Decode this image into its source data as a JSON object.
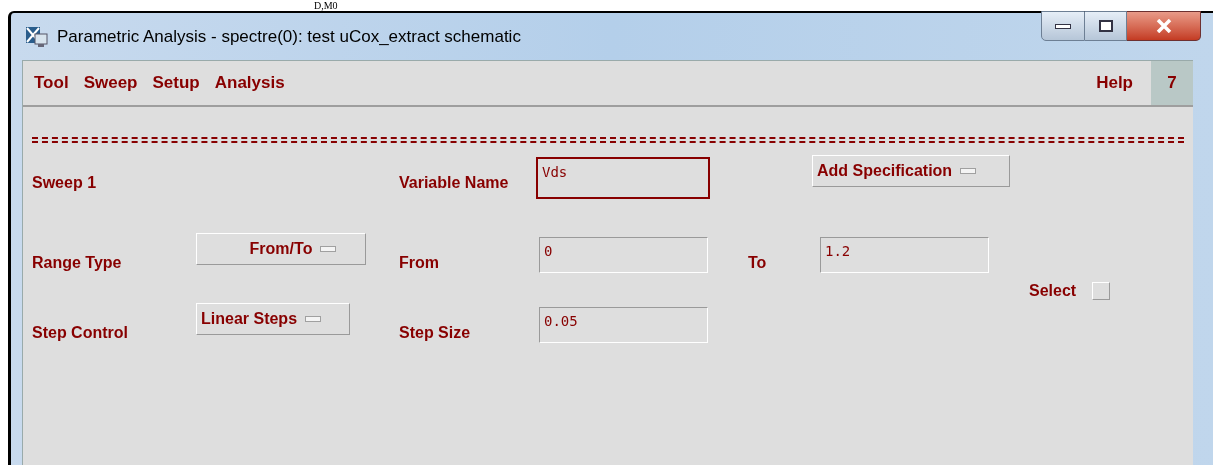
{
  "background_text": "D,M0",
  "window": {
    "title": "Parametric Analysis - spectre(0): test uCox_extract schematic"
  },
  "menu_bar": {
    "items": [
      "Tool",
      "Sweep",
      "Setup",
      "Analysis"
    ],
    "help": "Help",
    "badge": "7"
  },
  "sweep": {
    "title": "Sweep 1",
    "variable_name": {
      "label": "Variable Name",
      "value": "Vds",
      "focused": true
    },
    "add_specification": "Add Specification",
    "range_type": {
      "label": "Range Type",
      "value": "From/To"
    },
    "from": {
      "label": "From",
      "value": "0"
    },
    "to": {
      "label": "To",
      "value": "1.2"
    },
    "select": {
      "label": "Select",
      "checked": false
    },
    "step_control": {
      "label": "Step Control",
      "value": "Linear Steps"
    },
    "step_size": {
      "label": "Step Size",
      "value": "0.05"
    }
  }
}
